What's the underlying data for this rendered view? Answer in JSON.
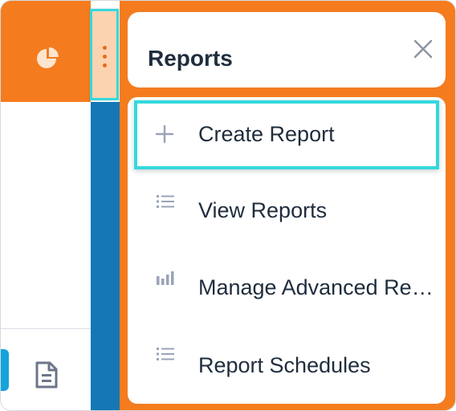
{
  "panel": {
    "title": "Reports",
    "close_icon": "close-icon"
  },
  "menu": {
    "items": [
      {
        "label": "Create Report",
        "icon": "plus-icon"
      },
      {
        "label": "View Reports",
        "icon": "list-icon"
      },
      {
        "label": "Manage Advanced Reports",
        "icon": "bar-chart-icon"
      },
      {
        "label": "Report Schedules",
        "icon": "list-icon"
      }
    ]
  },
  "colors": {
    "accent_orange": "#f47c1f",
    "highlight_cyan": "#35d8dd",
    "sidebar_blue": "#1577b5",
    "text_dark": "#1f2d3d",
    "icon_gray": "#9aa3b8"
  }
}
